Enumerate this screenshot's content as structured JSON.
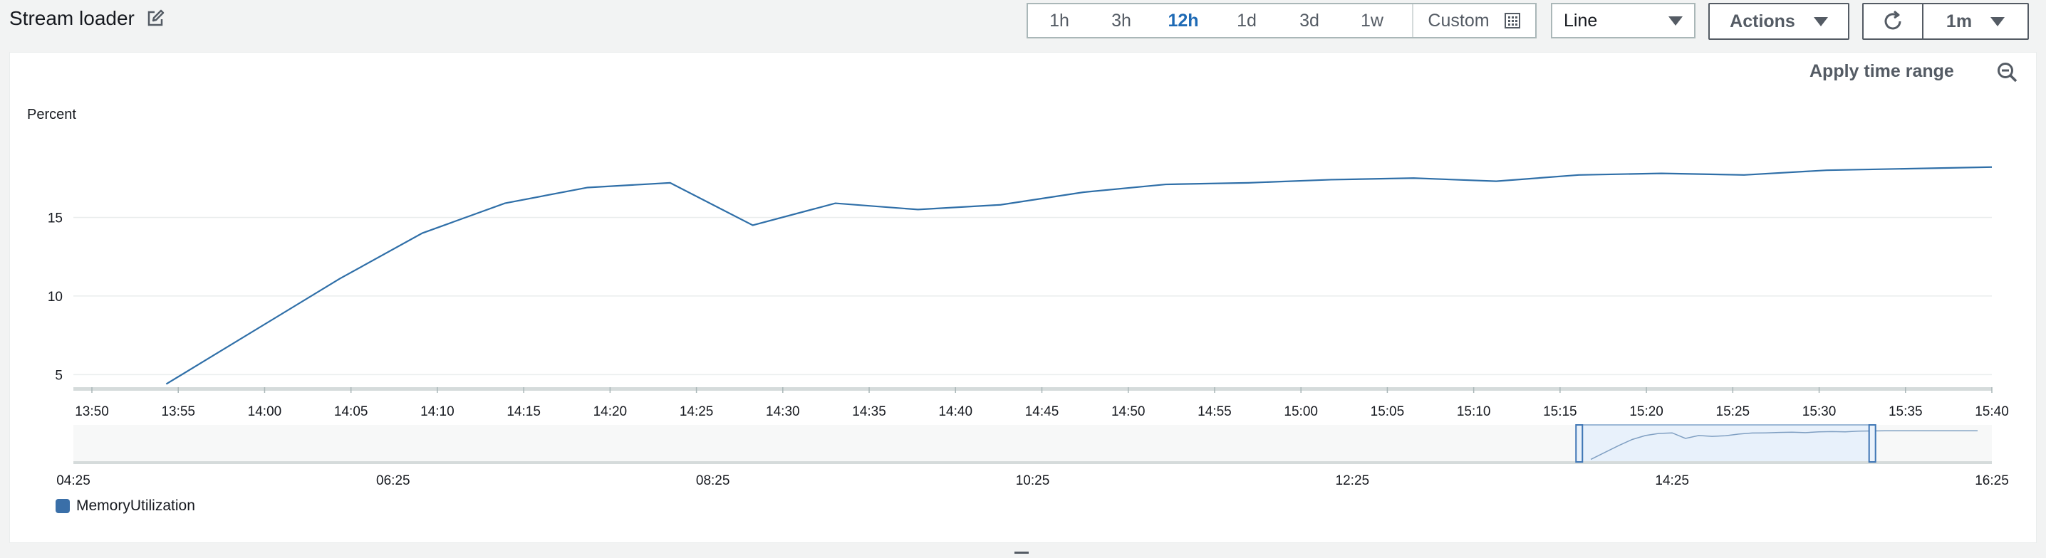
{
  "widget": {
    "title": "Stream loader"
  },
  "toolbar": {
    "ranges": [
      {
        "label": "1h",
        "active": false
      },
      {
        "label": "3h",
        "active": false
      },
      {
        "label": "12h",
        "active": true
      },
      {
        "label": "1d",
        "active": false
      },
      {
        "label": "3d",
        "active": false
      },
      {
        "label": "1w",
        "active": false
      }
    ],
    "custom_label": "Custom",
    "chart_type_label": "Line",
    "actions_label": "Actions",
    "refresh_interval_label": "1m"
  },
  "apply_time_range_label": "Apply time range",
  "colors": {
    "series": "#2f6fa8",
    "accent": "#1e6ab5",
    "navigator_fill": "#e8f1fb"
  },
  "chart_data": {
    "type": "line",
    "ylabel": "Percent",
    "yticks": [
      5,
      10,
      15
    ],
    "ylim": [
      4.2,
      20
    ],
    "x_tick_labels": [
      "13:50",
      "13:55",
      "14:00",
      "14:05",
      "14:10",
      "14:15",
      "14:20",
      "14:25",
      "14:30",
      "14:35",
      "14:40",
      "14:45",
      "14:50",
      "14:55",
      "15:00",
      "15:05",
      "15:10",
      "15:15",
      "15:20",
      "15:25",
      "15:30",
      "15:35",
      "15:40"
    ],
    "x_minutes": [
      0,
      115
    ],
    "series": [
      {
        "name": "MemoryUtilization",
        "x": [
          4.5,
          15,
          20,
          25,
          30,
          35,
          40,
          45,
          50,
          55,
          60,
          65,
          70,
          75,
          80,
          85,
          90,
          95,
          100,
          105,
          110,
          115
        ],
        "y": [
          4.4,
          11.1,
          14.0,
          15.9,
          16.9,
          17.2,
          14.5,
          15.9,
          15.5,
          15.8,
          16.6,
          17.1,
          17.2,
          17.4,
          17.5,
          17.3,
          17.7,
          17.8,
          17.7,
          18.0,
          18.1,
          18.2
        ]
      }
    ],
    "navigator": {
      "tick_labels": [
        "04:25",
        "06:25",
        "08:25",
        "10:25",
        "12:25",
        "14:25",
        "16:25"
      ],
      "selection_start": "13:50",
      "selection_end": "15:40"
    },
    "legend": [
      "MemoryUtilization"
    ]
  }
}
